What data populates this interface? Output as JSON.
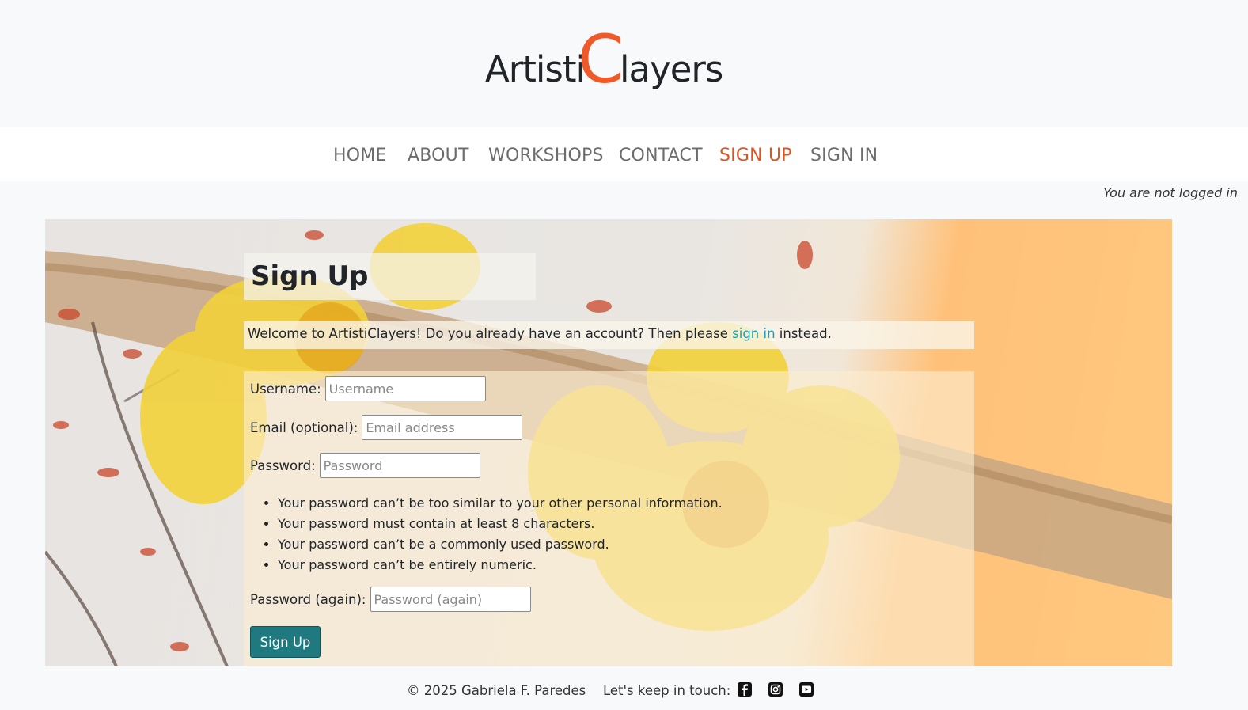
{
  "brand": {
    "part1": "Artisti",
    "big_letter": "C",
    "part2": "layers",
    "accent_color": "#f05a28"
  },
  "nav": {
    "items": [
      {
        "label": "HOME"
      },
      {
        "label": "ABOUT"
      },
      {
        "label": "WORKSHOPS"
      },
      {
        "label": "CONTACT"
      },
      {
        "label": "SIGN UP",
        "active": true
      },
      {
        "label": "SIGN IN"
      }
    ],
    "active_color": "#e05320"
  },
  "login_status": "You are not logged in",
  "signup": {
    "title": "Sign Up",
    "welcome": {
      "before": "Welcome to ArtistiClayers! Do you already have an account? Then please ",
      "link": "sign in",
      "after": " instead."
    },
    "fields": {
      "username": {
        "label": "Username:",
        "placeholder": "Username"
      },
      "email": {
        "label": "Email (optional):",
        "placeholder": "Email address"
      },
      "password": {
        "label": "Password:",
        "placeholder": "Password"
      },
      "password2": {
        "label": "Password (again):",
        "placeholder": "Password (again)"
      }
    },
    "rules": [
      "Your password can’t be too similar to your other personal information.",
      "Your password must contain at least 8 characters.",
      "Your password can’t be a commonly used password.",
      "Your password can’t be entirely numeric."
    ],
    "submit_label": "Sign Up",
    "button_color": "#1f7a80"
  },
  "footer": {
    "copyright": "© 2025 Gabriela F. Paredes",
    "touch": "Let's keep in touch:",
    "social_icons": [
      "facebook-icon",
      "instagram-icon",
      "youtube-icon"
    ]
  }
}
